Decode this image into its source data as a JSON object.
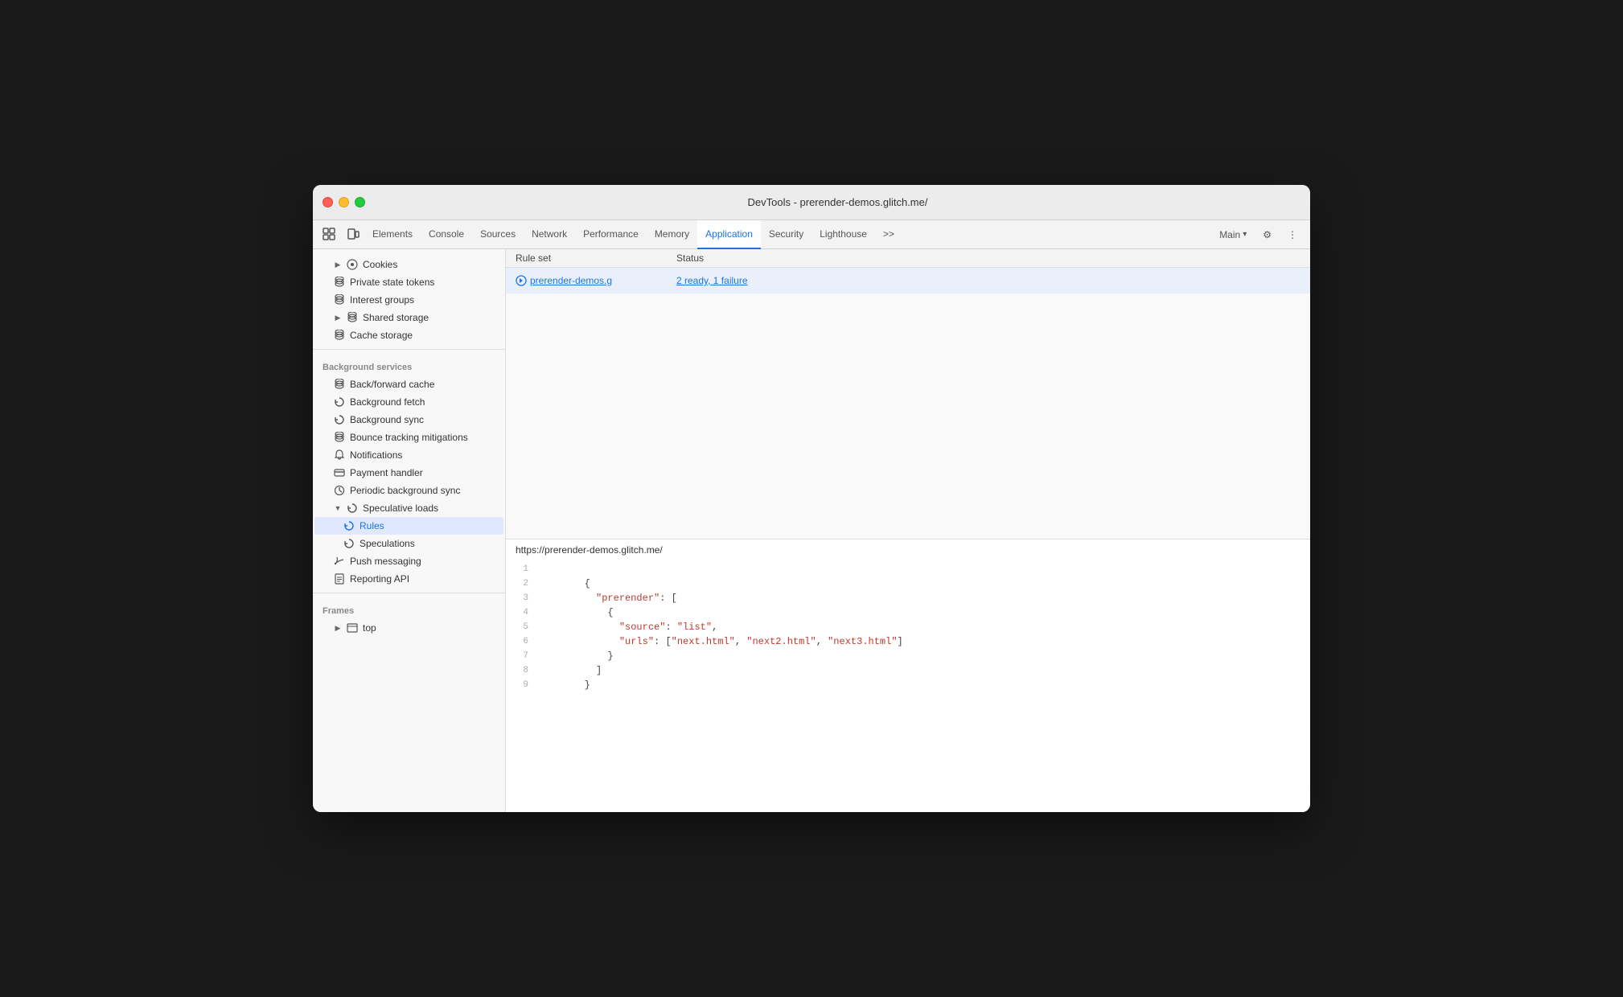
{
  "window": {
    "title": "DevTools - prerender-demos.glitch.me/"
  },
  "titlebar": {
    "title": "DevTools - prerender-demos.glitch.me/"
  },
  "tabbar": {
    "tabs": [
      {
        "id": "cursor-icon",
        "label": "⬡",
        "icon": true
      },
      {
        "id": "elements",
        "label": "Elements"
      },
      {
        "id": "console",
        "label": "Console"
      },
      {
        "id": "sources",
        "label": "Sources"
      },
      {
        "id": "network",
        "label": "Network"
      },
      {
        "id": "performance",
        "label": "Performance"
      },
      {
        "id": "memory",
        "label": "Memory"
      },
      {
        "id": "application",
        "label": "Application",
        "active": true
      },
      {
        "id": "security",
        "label": "Security"
      },
      {
        "id": "lighthouse",
        "label": "Lighthouse"
      },
      {
        "id": "more",
        "label": ">>"
      }
    ],
    "right": {
      "main_label": "Main",
      "settings_icon": "⚙",
      "more_icon": "⋮"
    }
  },
  "sidebar": {
    "sections": [
      {
        "id": "storage",
        "items": [
          {
            "id": "cookies",
            "label": "Cookies",
            "icon": "circle-dot",
            "indent": 1,
            "expandable": true
          },
          {
            "id": "private-state-tokens",
            "label": "Private state tokens",
            "icon": "db",
            "indent": 1
          },
          {
            "id": "interest-groups",
            "label": "Interest groups",
            "icon": "db",
            "indent": 1
          },
          {
            "id": "shared-storage",
            "label": "Shared storage",
            "icon": "db",
            "indent": 1,
            "expandable": true
          },
          {
            "id": "cache-storage",
            "label": "Cache storage",
            "icon": "db",
            "indent": 1
          }
        ]
      },
      {
        "id": "background-services",
        "label": "Background services",
        "items": [
          {
            "id": "back-forward-cache",
            "label": "Back/forward cache",
            "icon": "db",
            "indent": 1
          },
          {
            "id": "background-fetch",
            "label": "Background fetch",
            "icon": "sync",
            "indent": 1
          },
          {
            "id": "background-sync",
            "label": "Background sync",
            "icon": "sync",
            "indent": 1
          },
          {
            "id": "bounce-tracking",
            "label": "Bounce tracking mitigations",
            "icon": "db",
            "indent": 1
          },
          {
            "id": "notifications",
            "label": "Notifications",
            "icon": "bell",
            "indent": 1
          },
          {
            "id": "payment-handler",
            "label": "Payment handler",
            "icon": "card",
            "indent": 1
          },
          {
            "id": "periodic-bg-sync",
            "label": "Periodic background sync",
            "icon": "clock",
            "indent": 1
          },
          {
            "id": "speculative-loads",
            "label": "Speculative loads",
            "icon": "sync",
            "indent": 1,
            "expandable": true,
            "expanded": true
          },
          {
            "id": "rules",
            "label": "Rules",
            "icon": "sync",
            "indent": 2,
            "active": true
          },
          {
            "id": "speculations",
            "label": "Speculations",
            "icon": "sync",
            "indent": 2
          },
          {
            "id": "push-messaging",
            "label": "Push messaging",
            "icon": "cloud",
            "indent": 1
          },
          {
            "id": "reporting-api",
            "label": "Reporting API",
            "icon": "doc",
            "indent": 1
          }
        ]
      },
      {
        "id": "frames",
        "label": "Frames",
        "items": [
          {
            "id": "top",
            "label": "top",
            "icon": "frame",
            "indent": 1,
            "expandable": true
          }
        ]
      }
    ]
  },
  "main": {
    "table": {
      "headers": [
        "Rule set",
        "Status"
      ],
      "rows": [
        {
          "ruleset": "prerender-demos.g",
          "status": "2 ready, 1 failure",
          "icon": "speculate"
        }
      ]
    },
    "url": "https://prerender-demos.glitch.me/",
    "code": {
      "lines": [
        {
          "num": "1",
          "content": ""
        },
        {
          "num": "2",
          "content": "        {"
        },
        {
          "num": "3",
          "content": "          \"prerender\": ["
        },
        {
          "num": "4",
          "content": "            {"
        },
        {
          "num": "5",
          "content": "              \"source\": \"list\","
        },
        {
          "num": "6",
          "content": "              \"urls\": [\"next.html\", \"next2.html\", \"next3.html\"]"
        },
        {
          "num": "7",
          "content": "            }"
        },
        {
          "num": "8",
          "content": "          ]"
        },
        {
          "num": "9",
          "content": "        }"
        }
      ]
    }
  },
  "colors": {
    "accent": "#1a73e8",
    "active_row": "#eaf0fb",
    "sidebar_active": "#e0e8ff"
  }
}
